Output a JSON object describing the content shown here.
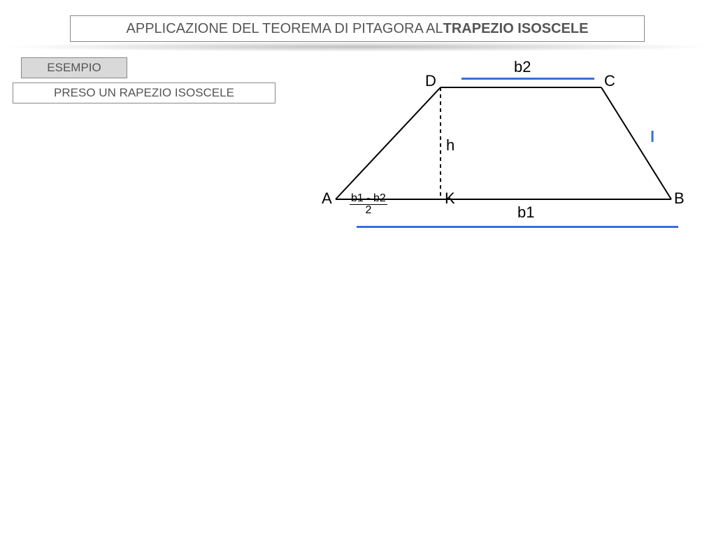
{
  "title": {
    "part1": "APPLICAZIONE DEL TEOREMA DI PITAGORA AL ",
    "part2_bold": "TRAPEZIO ISOSCELE"
  },
  "esempio_label": "ESEMPIO",
  "step_label": "PRESO UN RAPEZIO ISOSCELE",
  "diagram": {
    "A": "A",
    "B": "B",
    "C": "C",
    "D": "D",
    "K": "K",
    "h": "h",
    "b1": "b1",
    "b2": "b2",
    "l": "l",
    "frac_num": "b1 - b2",
    "frac_den": "2"
  },
  "chart_data": {
    "type": "diagram",
    "description": "Isosceles trapezoid ABCD with major base AB (b1), minor base DC (b2), height DK (h) dropped from D onto AB at K, lateral side CB labeled l, segment AK labeled (b1-b2)/2.",
    "vertices": [
      "A",
      "B",
      "C",
      "D",
      "K"
    ],
    "labels": {
      "major_base": "b1",
      "minor_base": "b2",
      "height": "h",
      "lateral": "l",
      "AK": "(b1-b2)/2"
    }
  }
}
